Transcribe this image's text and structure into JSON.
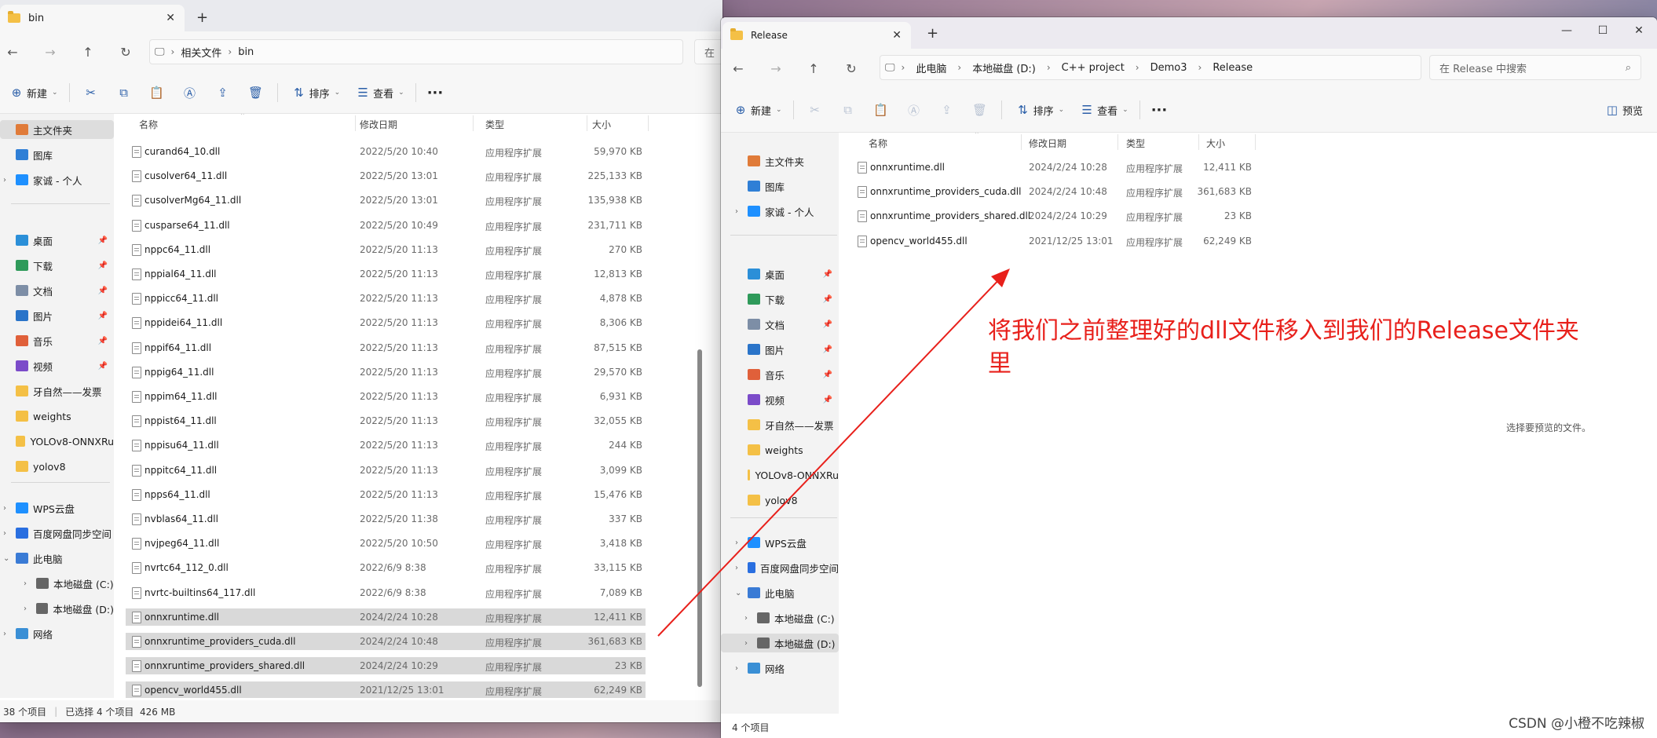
{
  "left": {
    "tab_title": "bin",
    "breadcrumbs": [
      "相关文件",
      "bin"
    ],
    "toolbar": {
      "new": "新建",
      "sort": "排序",
      "view": "查看"
    },
    "columns": {
      "name": "名称",
      "date": "修改日期",
      "type": "类型",
      "size": "大小"
    },
    "sidebar": [
      {
        "label": "主文件夹",
        "icon": "home-icon"
      },
      {
        "label": "图库",
        "icon": "gallery-icon"
      },
      {
        "label": "家诚 - 个人",
        "icon": "cloud-icon"
      },
      {
        "label": "桌面",
        "icon": "desktop-icon"
      },
      {
        "label": "下载",
        "icon": "download-icon"
      },
      {
        "label": "文档",
        "icon": "document-icon"
      },
      {
        "label": "图片",
        "icon": "pictures-icon"
      },
      {
        "label": "音乐",
        "icon": "music-icon"
      },
      {
        "label": "视频",
        "icon": "video-icon"
      },
      {
        "label": "牙自然——发票",
        "icon": "folder-icon"
      },
      {
        "label": "weights",
        "icon": "folder-icon"
      },
      {
        "label": "YOLOv8-ONNXRu",
        "icon": "folder-icon"
      },
      {
        "label": "yolov8",
        "icon": "folder-icon"
      },
      {
        "label": "WPS云盘",
        "icon": "cloud-icon"
      },
      {
        "label": "百度网盘同步空间",
        "icon": "baidu-icon"
      },
      {
        "label": "此电脑",
        "icon": "computer-icon"
      },
      {
        "label": "本地磁盘 (C:)",
        "icon": "drive-icon"
      },
      {
        "label": "本地磁盘 (D:)",
        "icon": "drive-icon"
      },
      {
        "label": "网络",
        "icon": "network-icon"
      }
    ],
    "files": [
      {
        "name": "curand64_10.dll",
        "date": "2022/5/20 10:40",
        "type": "应用程序扩展",
        "size": "59,970 KB"
      },
      {
        "name": "cusolver64_11.dll",
        "date": "2022/5/20 13:01",
        "type": "应用程序扩展",
        "size": "225,133 KB"
      },
      {
        "name": "cusolverMg64_11.dll",
        "date": "2022/5/20 13:01",
        "type": "应用程序扩展",
        "size": "135,938 KB"
      },
      {
        "name": "cusparse64_11.dll",
        "date": "2022/5/20 10:49",
        "type": "应用程序扩展",
        "size": "231,711 KB"
      },
      {
        "name": "nppc64_11.dll",
        "date": "2022/5/20 11:13",
        "type": "应用程序扩展",
        "size": "270 KB"
      },
      {
        "name": "nppial64_11.dll",
        "date": "2022/5/20 11:13",
        "type": "应用程序扩展",
        "size": "12,813 KB"
      },
      {
        "name": "nppicc64_11.dll",
        "date": "2022/5/20 11:13",
        "type": "应用程序扩展",
        "size": "4,878 KB"
      },
      {
        "name": "nppidei64_11.dll",
        "date": "2022/5/20 11:13",
        "type": "应用程序扩展",
        "size": "8,306 KB"
      },
      {
        "name": "nppif64_11.dll",
        "date": "2022/5/20 11:13",
        "type": "应用程序扩展",
        "size": "87,515 KB"
      },
      {
        "name": "nppig64_11.dll",
        "date": "2022/5/20 11:13",
        "type": "应用程序扩展",
        "size": "29,570 KB"
      },
      {
        "name": "nppim64_11.dll",
        "date": "2022/5/20 11:13",
        "type": "应用程序扩展",
        "size": "6,931 KB"
      },
      {
        "name": "nppist64_11.dll",
        "date": "2022/5/20 11:13",
        "type": "应用程序扩展",
        "size": "32,055 KB"
      },
      {
        "name": "nppisu64_11.dll",
        "date": "2022/5/20 11:13",
        "type": "应用程序扩展",
        "size": "244 KB"
      },
      {
        "name": "nppitc64_11.dll",
        "date": "2022/5/20 11:13",
        "type": "应用程序扩展",
        "size": "3,099 KB"
      },
      {
        "name": "npps64_11.dll",
        "date": "2022/5/20 11:13",
        "type": "应用程序扩展",
        "size": "15,476 KB"
      },
      {
        "name": "nvblas64_11.dll",
        "date": "2022/5/20 11:38",
        "type": "应用程序扩展",
        "size": "337 KB"
      },
      {
        "name": "nvjpeg64_11.dll",
        "date": "2022/5/20 10:50",
        "type": "应用程序扩展",
        "size": "3,418 KB"
      },
      {
        "name": "nvrtc64_112_0.dll",
        "date": "2022/6/9 8:38",
        "type": "应用程序扩展",
        "size": "33,115 KB"
      },
      {
        "name": "nvrtc-builtins64_117.dll",
        "date": "2022/6/9 8:38",
        "type": "应用程序扩展",
        "size": "7,089 KB"
      },
      {
        "name": "onnxruntime.dll",
        "date": "2024/2/24 10:28",
        "type": "应用程序扩展",
        "size": "12,411 KB",
        "selected": true
      },
      {
        "name": "onnxruntime_providers_cuda.dll",
        "date": "2024/2/24 10:48",
        "type": "应用程序扩展",
        "size": "361,683 KB",
        "selected": true
      },
      {
        "name": "onnxruntime_providers_shared.dll",
        "date": "2024/2/24 10:29",
        "type": "应用程序扩展",
        "size": "23 KB",
        "selected": true
      },
      {
        "name": "opencv_world455.dll",
        "date": "2021/12/25 13:01",
        "type": "应用程序扩展",
        "size": "62,249 KB",
        "selected": true
      }
    ],
    "status": {
      "count": "38 个项目",
      "selected": "已选择 4 个项目  426 MB"
    },
    "search_stub": "在"
  },
  "right": {
    "tab_title": "Release",
    "breadcrumbs": [
      "此电脑",
      "本地磁盘 (D:)",
      "C++ project",
      "Demo3",
      "Release"
    ],
    "search_placeholder": "在 Release 中搜索",
    "toolbar": {
      "new": "新建",
      "sort": "排序",
      "view": "查看",
      "preview": "预览"
    },
    "columns": {
      "name": "名称",
      "date": "修改日期",
      "type": "类型",
      "size": "大小"
    },
    "sidebar": [
      {
        "label": "主文件夹",
        "icon": "home-icon"
      },
      {
        "label": "图库",
        "icon": "gallery-icon"
      },
      {
        "label": "家诚 - 个人",
        "icon": "cloud-icon"
      },
      {
        "label": "桌面",
        "icon": "desktop-icon"
      },
      {
        "label": "下载",
        "icon": "download-icon"
      },
      {
        "label": "文档",
        "icon": "document-icon"
      },
      {
        "label": "图片",
        "icon": "pictures-icon"
      },
      {
        "label": "音乐",
        "icon": "music-icon"
      },
      {
        "label": "视频",
        "icon": "video-icon"
      },
      {
        "label": "牙自然——发票",
        "icon": "folder-icon"
      },
      {
        "label": "weights",
        "icon": "folder-icon"
      },
      {
        "label": "YOLOv8-ONNXRu",
        "icon": "folder-icon"
      },
      {
        "label": "yolov8",
        "icon": "folder-icon"
      },
      {
        "label": "WPS云盘",
        "icon": "cloud-icon"
      },
      {
        "label": "百度网盘同步空间",
        "icon": "baidu-icon"
      },
      {
        "label": "此电脑",
        "icon": "computer-icon"
      },
      {
        "label": "本地磁盘 (C:)",
        "icon": "drive-icon"
      },
      {
        "label": "本地磁盘 (D:)",
        "icon": "drive-icon"
      },
      {
        "label": "网络",
        "icon": "network-icon"
      }
    ],
    "files": [
      {
        "name": "onnxruntime.dll",
        "date": "2024/2/24 10:28",
        "type": "应用程序扩展",
        "size": "12,411 KB"
      },
      {
        "name": "onnxruntime_providers_cuda.dll",
        "date": "2024/2/24 10:48",
        "type": "应用程序扩展",
        "size": "361,683 KB"
      },
      {
        "name": "onnxruntime_providers_shared.dll",
        "date": "2024/2/24 10:29",
        "type": "应用程序扩展",
        "size": "23 KB"
      },
      {
        "name": "opencv_world455.dll",
        "date": "2021/12/25 13:01",
        "type": "应用程序扩展",
        "size": "62,249 KB"
      }
    ],
    "preview_message": "选择要预览的文件。",
    "status": {
      "count": "4 个项目"
    }
  },
  "annotation": {
    "text": "将我们之前整理好的dll文件移入到我们的Release文件夹里",
    "color": "#e8201b"
  },
  "watermark": "CSDN @小橙不吃辣椒"
}
